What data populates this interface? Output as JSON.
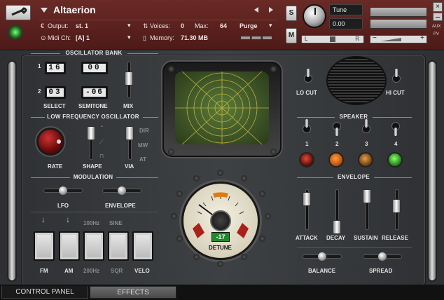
{
  "header": {
    "instrument_name": "Altaerion",
    "output_label": "Output:",
    "output_value": "st. 1",
    "midi_label": "Midi Ch:",
    "midi_value": "[A] 1",
    "voices_label": "Voices:",
    "voices_value": "0",
    "max_label": "Max:",
    "max_value": "64",
    "memory_label": "Memory:",
    "memory_value": "71.30 MB",
    "purge_label": "Purge",
    "solo_label": "S",
    "mute_label": "M",
    "tune_label": "Tune",
    "tune_value": "0.00",
    "pan_left": "L",
    "pan_right": "R",
    "aux_label": "AUX",
    "pv_label": "PV"
  },
  "oscillator_bank": {
    "title": "OSCILLATOR BANK",
    "row1_number": "1",
    "row1_select": "16",
    "row1_semitone": "00",
    "row2_number": "2",
    "row2_select": "03",
    "row2_semitone": "-06",
    "select_label": "SELECT",
    "semitone_label": "SEMITONE",
    "mix_label": "MIX"
  },
  "lfo": {
    "title": "LOW FREQUENCY OSCILLATOR",
    "rate_label": "RATE",
    "shape_label": "SHAPE",
    "via_label": "VIA",
    "via_options": [
      "DIR",
      "MW",
      "AT"
    ]
  },
  "modulation": {
    "title": "MODULATION",
    "lfo_label": "LFO",
    "envelope_label": "ENVELOPE"
  },
  "pads": {
    "hz100_label": "100Hz",
    "sine_label": "SINE",
    "labels": [
      "FM",
      "AM",
      "200Hz",
      "SQR",
      "VELO"
    ]
  },
  "center": {
    "detune_value": "-17",
    "detune_label": "DETUNE"
  },
  "right": {
    "lo_cut_label": "LO CUT",
    "hi_cut_label": "HI CUT",
    "speaker_title": "SPEAKER",
    "speaker_numbers": [
      "1",
      "2",
      "3",
      "4"
    ],
    "envelope_title": "ENVELOPE",
    "attack_label": "ATTACK",
    "decay_label": "DECAY",
    "sustain_label": "SUSTAIN",
    "release_label": "RELEASE",
    "balance_label": "BALANCE",
    "spread_label": "SPREAD"
  },
  "tabs": {
    "control_panel": "CONTROL PANEL",
    "effects": "EFFECTS"
  },
  "colors": {
    "header_bg": "#5a2220",
    "screen_green": "#3f5a2a",
    "grid_yellow": "#d8c23a",
    "detune_green": "#1f8a2a",
    "lamp_red": "#a81a14",
    "lamp_orange": "#e26a10",
    "lamp_amber": "#b8781a",
    "lamp_green": "#3bbf2a"
  }
}
